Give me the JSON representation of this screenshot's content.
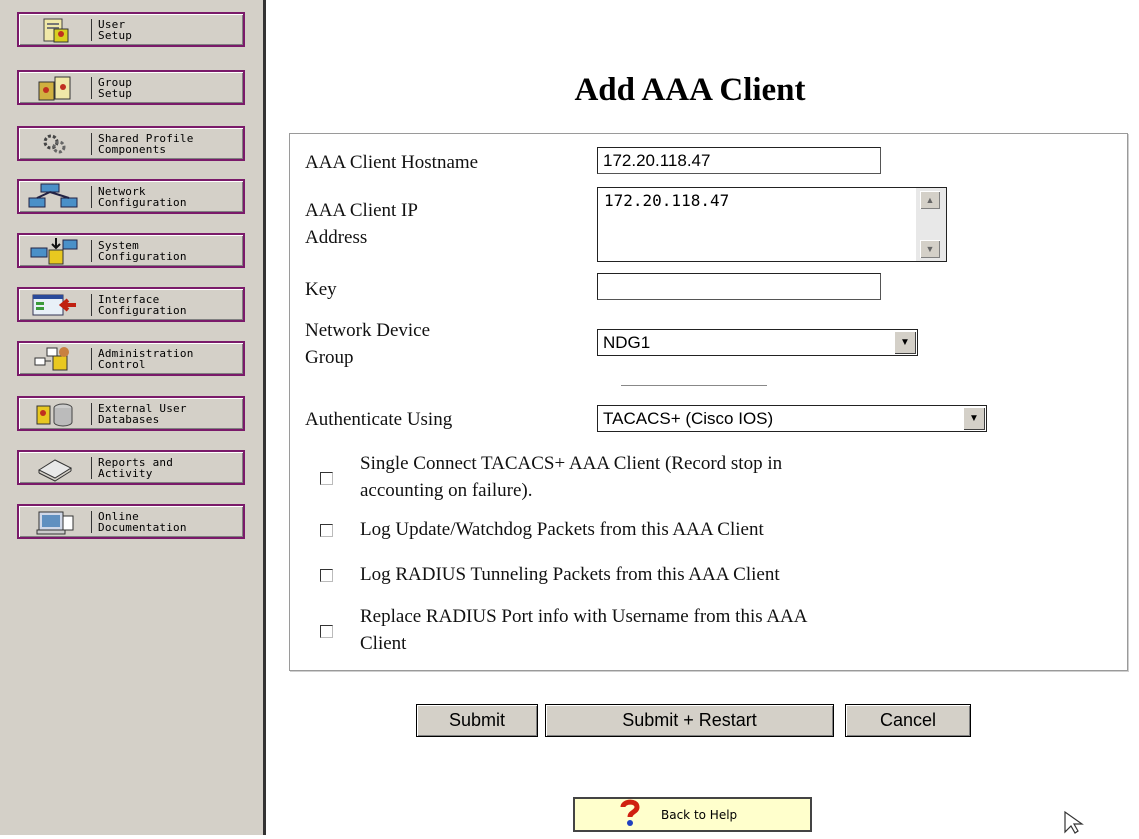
{
  "sidebar": {
    "items": [
      {
        "label": "User\nSetup",
        "icon": "user-setup-icon"
      },
      {
        "label": "Group\nSetup",
        "icon": "group-setup-icon"
      },
      {
        "label": "Shared Profile\nComponents",
        "icon": "shared-profile-icon"
      },
      {
        "label": "Network\nConfiguration",
        "icon": "network-config-icon"
      },
      {
        "label": "System\nConfiguration",
        "icon": "system-config-icon"
      },
      {
        "label": "Interface\nConfiguration",
        "icon": "interface-config-icon"
      },
      {
        "label": "Administration\nControl",
        "icon": "admin-control-icon"
      },
      {
        "label": "External User\nDatabases",
        "icon": "external-db-icon"
      },
      {
        "label": "Reports and\nActivity",
        "icon": "reports-icon"
      },
      {
        "label": "Online\nDocumentation",
        "icon": "documentation-icon"
      }
    ]
  },
  "page": {
    "title": "Add AAA Client"
  },
  "form": {
    "hostname_label": "AAA Client Hostname",
    "hostname_value": "172.20.118.47",
    "ip_label_line1": "AAA Client IP",
    "ip_label_line2": "Address",
    "ip_value": "172.20.118.47",
    "key_label": "Key",
    "key_value": "",
    "ndg_label_line1": "Network Device",
    "ndg_label_line2": "Group",
    "ndg_value": "NDG1",
    "auth_label": "Authenticate Using",
    "auth_value": "TACACS+ (Cisco IOS)",
    "checkboxes": [
      {
        "line1": "Single Connect TACACS+ AAA Client (Record stop in",
        "line2": "accounting on failure).",
        "checked": false
      },
      {
        "line1": "Log Update/Watchdog Packets from this AAA Client",
        "line2": "",
        "checked": false
      },
      {
        "line1": "Log RADIUS Tunneling Packets from this AAA Client",
        "line2": "",
        "checked": false
      },
      {
        "line1": "Replace RADIUS Port info with Username from this AAA",
        "line2": "Client",
        "checked": false
      }
    ]
  },
  "buttons": {
    "submit": "Submit",
    "submit_restart": "Submit + Restart",
    "cancel": "Cancel"
  },
  "help": {
    "back_label": "Back to Help"
  }
}
